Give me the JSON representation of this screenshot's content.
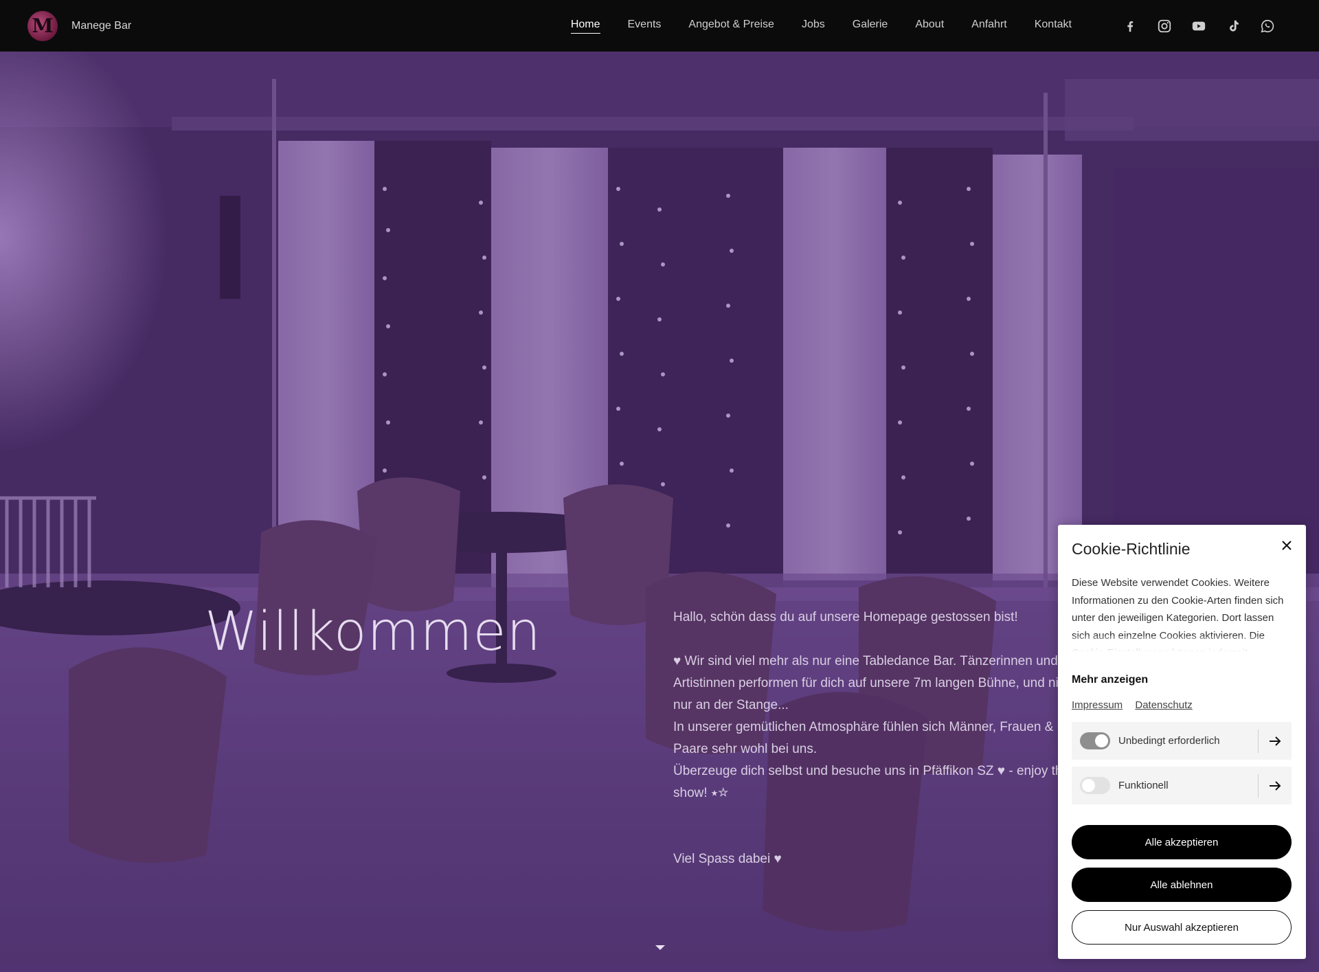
{
  "brand": {
    "logo_letter": "M",
    "name": "Manege Bar"
  },
  "nav": {
    "links": [
      "Home",
      "Events",
      "Angebot & Preise",
      "Jobs",
      "Galerie",
      "About",
      "Anfahrt",
      "Kontakt"
    ],
    "active": "Home"
  },
  "social": [
    "facebook-icon",
    "instagram-icon",
    "youtube-icon",
    "tiktok-icon",
    "whatsapp-icon"
  ],
  "hero": {
    "title": "Willkommen",
    "greeting": "Hallo, schön dass du auf unsere Homepage gestossen bist!",
    "paragraph_1": "♥ Wir sind viel mehr als nur eine Tabledance Bar. Tänzerinnen und Artistinnen performen für dich auf unsere 7m langen Bühne, und nicht nur an der Stange...",
    "paragraph_2": "In unserer gemütlichen Atmosphäre fühlen sich Männer, Frauen & Paare sehr wohl bei uns.",
    "paragraph_3": "Überzeuge dich selbst und besuche uns in Pfäffikon SZ ♥  - enjoy the show! ⭑☆",
    "closing": "Viel Spass dabei ♥"
  },
  "cookie": {
    "title": "Cookie-Richtlinie",
    "description": "Diese Website verwendet Cookies. Weitere Informationen zu den Cookie-Arten finden sich unter den jeweiligen Kategorien. Dort lassen sich auch einzelne Cookies aktivieren. Die Cookie-Einstellungen können jederzeit",
    "show_more": "Mehr anzeigen",
    "link_impressum": "Impressum",
    "link_datenschutz": "Datenschutz",
    "categories": [
      {
        "label": "Unbedingt erforderlich",
        "enabled": true
      },
      {
        "label": "Funktionell",
        "enabled": false
      }
    ],
    "btn_accept_all": "Alle akzeptieren",
    "btn_reject_all": "Alle ablehnen",
    "btn_accept_selection": "Nur Auswahl akzeptieren"
  }
}
